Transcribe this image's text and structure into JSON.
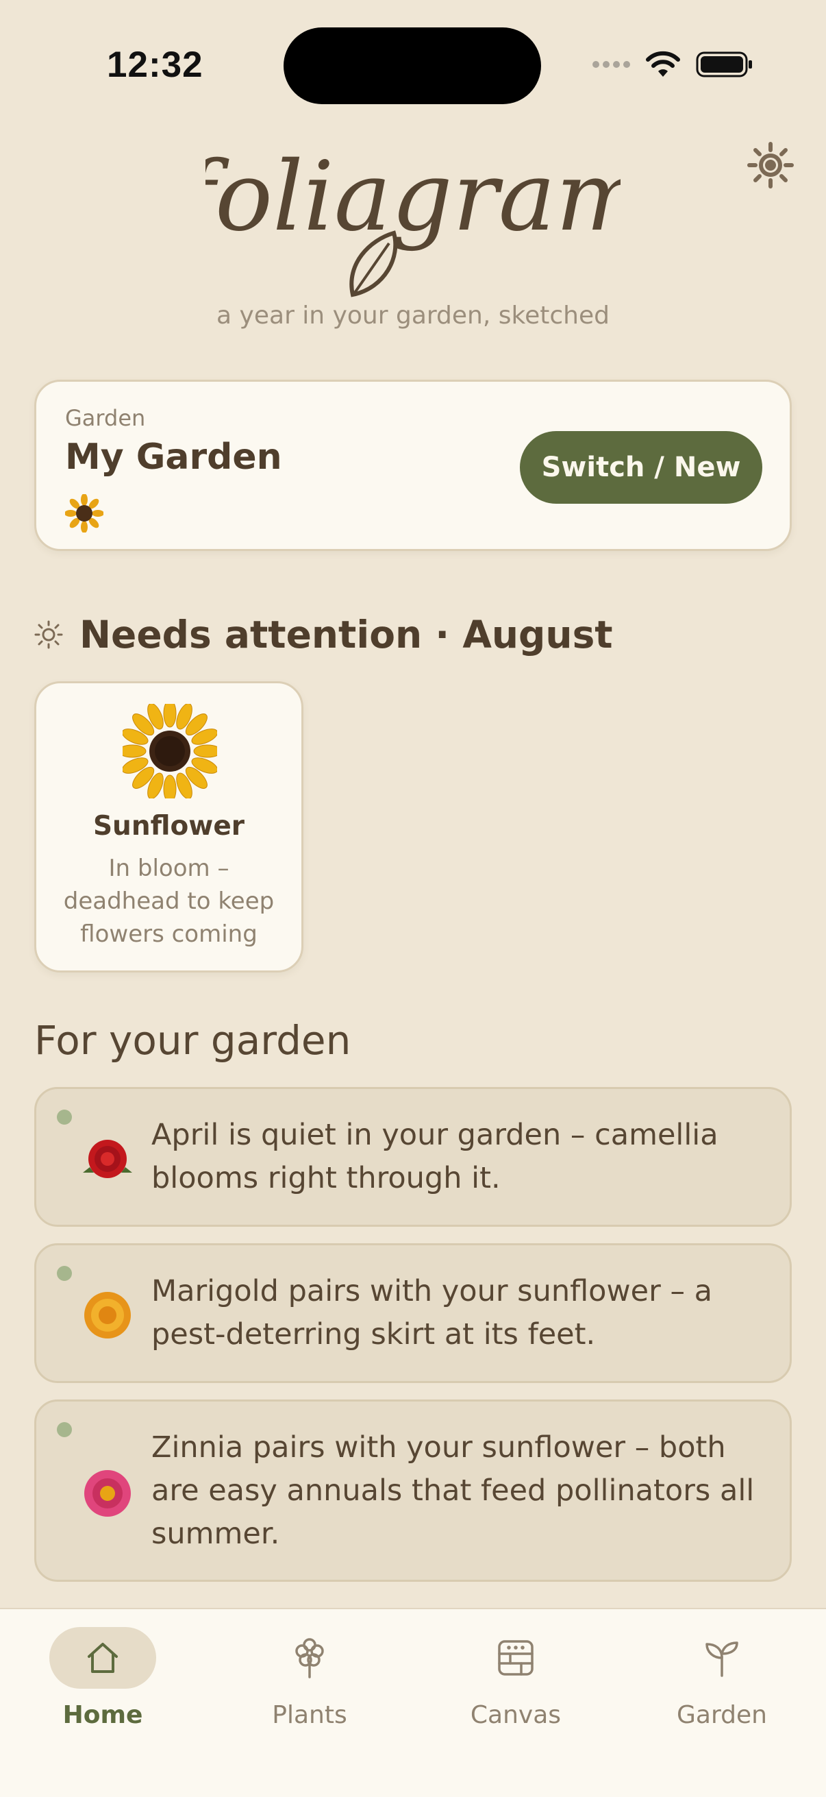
{
  "status_bar": {
    "time": "12:32"
  },
  "header": {
    "app_name": "foliagram",
    "tagline": "a year in your garden, sketched",
    "settings_icon": "gear-icon"
  },
  "garden_card": {
    "label": "Garden",
    "name": "My Garden",
    "emoji_icon": "sunflower-icon",
    "switch_label": "Switch / New"
  },
  "attention": {
    "icon": "sun-icon",
    "title": "Needs attention · August",
    "plants": [
      {
        "name": "Sunflower",
        "note": "In bloom – deadhead to keep flowers coming",
        "icon": "sunflower-icon"
      }
    ]
  },
  "suggestions": {
    "title": "For your garden",
    "items": [
      {
        "icon": "camellia-icon",
        "text": "April is quiet in your garden – camellia blooms right through it."
      },
      {
        "icon": "marigold-icon",
        "text": "Marigold pairs with your sunflower – a pest-deterring skirt at its feet."
      },
      {
        "icon": "zinnia-icon",
        "text": "Zinnia pairs with your sunflower – both are easy annuals that feed pollinators all summer."
      }
    ]
  },
  "tabs": [
    {
      "label": "Home",
      "icon": "home-icon",
      "active": true
    },
    {
      "label": "Plants",
      "icon": "flower-icon",
      "active": false
    },
    {
      "label": "Canvas",
      "icon": "canvas-icon",
      "active": false
    },
    {
      "label": "Garden",
      "icon": "sprout-icon",
      "active": false
    }
  ],
  "colors": {
    "background": "#efe6d5",
    "accent": "#5d6b3e",
    "text": "#574633",
    "muted": "#8f8270"
  }
}
